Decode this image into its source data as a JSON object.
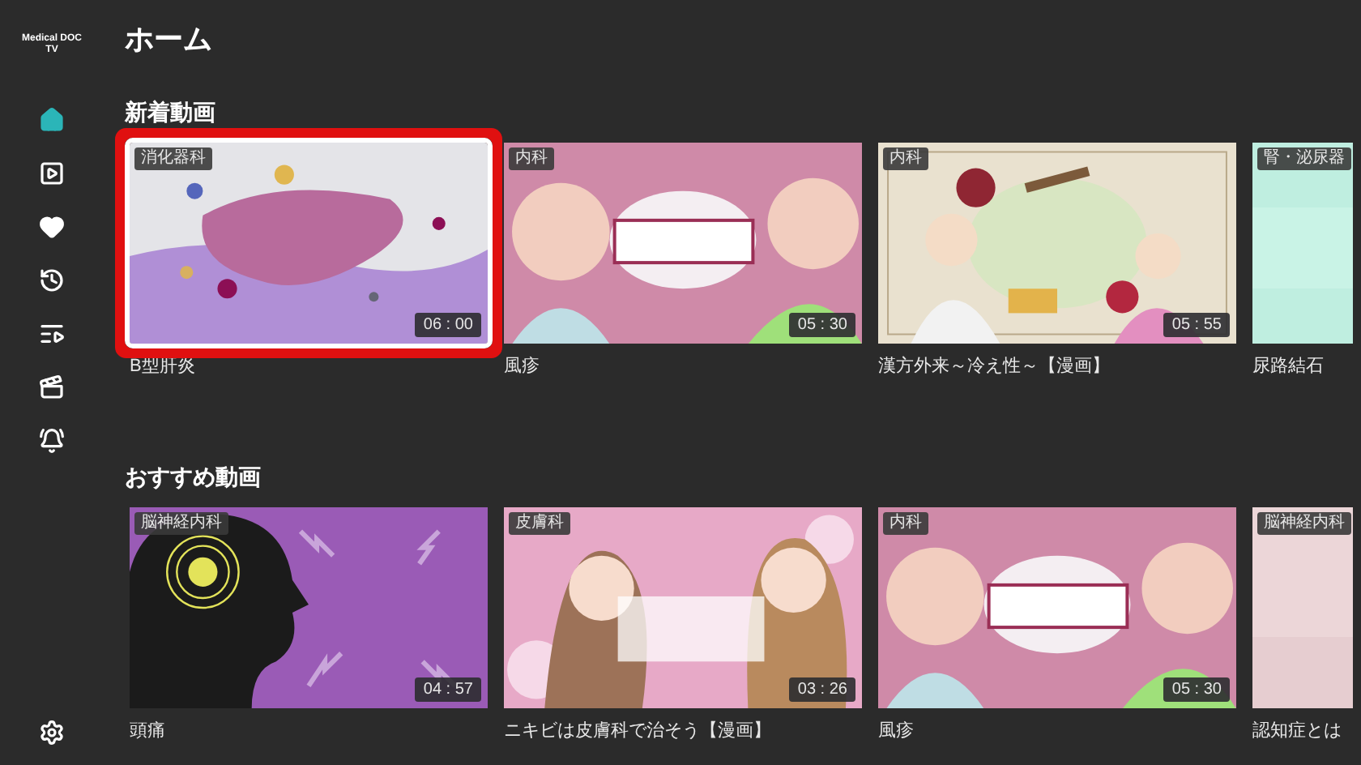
{
  "logo": {
    "lines": [
      "Medical DOC",
      "TV"
    ]
  },
  "sidebar": {
    "items": [
      {
        "kind": "home",
        "selected": true
      },
      {
        "kind": "library",
        "selected": false
      },
      {
        "kind": "favorites",
        "selected": false
      },
      {
        "kind": "history",
        "selected": false
      },
      {
        "kind": "playlist",
        "selected": false
      },
      {
        "kind": "movies",
        "selected": false
      },
      {
        "kind": "alerts",
        "selected": false
      }
    ],
    "settings": {
      "kind": "settings",
      "selected": false
    }
  },
  "page_title": "ホーム",
  "sections": [
    {
      "title": "新着動画",
      "videos": [
        {
          "category": "消化器科",
          "duration": "06 : 00",
          "title": "B型肝炎",
          "selected": true
        },
        {
          "category": "内科",
          "duration": "05 : 30",
          "title": "風疹",
          "selected": false
        },
        {
          "category": "内科",
          "duration": "05 : 55",
          "title": "漢方外来～冷え性～【漫画】",
          "selected": false
        },
        {
          "category": "腎・泌尿器",
          "title": "尿路結石",
          "selected": false
        }
      ]
    },
    {
      "title": "おすすめ動画",
      "videos": [
        {
          "category": "脳神経内科",
          "duration": "04 : 57",
          "title": "頭痛",
          "selected": false
        },
        {
          "category": "皮膚科",
          "duration": "03 : 26",
          "title": "ニキビは皮膚科で治そう【漫画】",
          "selected": false
        },
        {
          "category": "内科",
          "duration": "05 : 30",
          "title": "風疹",
          "selected": false
        },
        {
          "category": "脳神経内科",
          "title": "認知症とは",
          "selected": false
        }
      ]
    }
  ]
}
